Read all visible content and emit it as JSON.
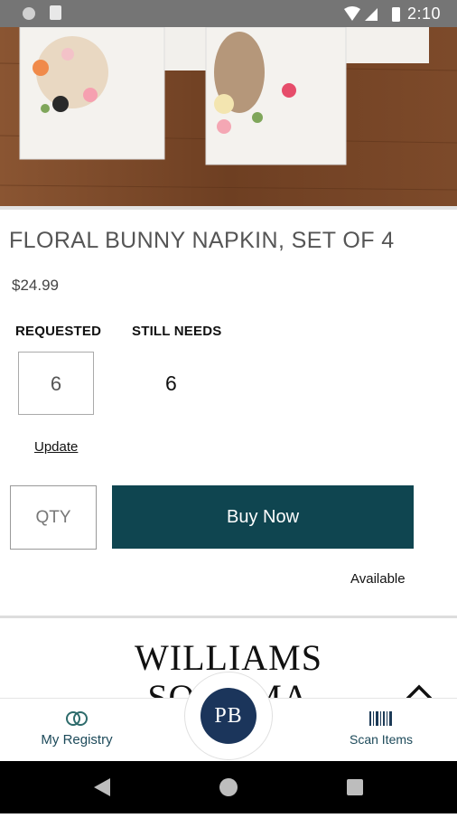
{
  "status_bar": {
    "time": "2:10"
  },
  "product": {
    "title": "FLORAL BUNNY NAPKIN, SET OF 4",
    "price": "$24.99"
  },
  "registry": {
    "requested_label": "REQUESTED",
    "requested_value": "6",
    "still_needs_label": "STILL NEEDS",
    "still_needs_value": "6",
    "update_label": "Update"
  },
  "purchase": {
    "qty_placeholder": "QTY",
    "buy_label": "Buy Now",
    "availability": "Available"
  },
  "brand_banner": {
    "line1": "WILLIAMS",
    "line2": "SONOMA"
  },
  "bottom_nav": {
    "my_registry": "My Registry",
    "center_logo": "PB",
    "scan_items": "Scan Items"
  },
  "colors": {
    "buy_button": "#0f4550",
    "pb_logo": "#1b355b",
    "nav_text": "#1d4a5a"
  },
  "icons": [
    "sd-card-icon",
    "wifi-icon",
    "cell-signal-icon",
    "battery-icon",
    "rings-icon",
    "barcode-icon",
    "chevron-up-icon",
    "back-icon",
    "home-icon",
    "recents-icon"
  ]
}
